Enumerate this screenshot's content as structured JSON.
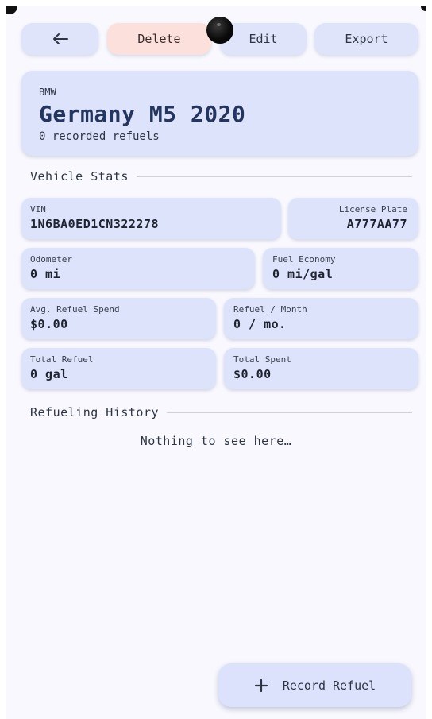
{
  "toolbar": {
    "back_icon": "arrow-left-icon",
    "delete_label": "Delete",
    "edit_label": "Edit",
    "export_label": "Export"
  },
  "vehicle": {
    "make": "BMW",
    "model": "Germany M5 2020",
    "refuels_text": "0 recorded refuels"
  },
  "sections": {
    "stats_title": "Vehicle Stats",
    "history_title": "Refueling History"
  },
  "stats": {
    "vin": {
      "label": "VIN",
      "value": "1N6BA0ED1CN322278"
    },
    "license_plate": {
      "label": "License Plate",
      "value": "A777AA77"
    },
    "odometer": {
      "label": "Odometer",
      "value": "0 mi"
    },
    "fuel_economy": {
      "label": "Fuel Economy",
      "value": "0 mi/gal"
    },
    "avg_refuel_spend": {
      "label": "Avg. Refuel Spend",
      "value": "$0.00"
    },
    "refuel_per_month": {
      "label": "Refuel / Month",
      "value": "0 / mo."
    },
    "total_refuel": {
      "label": "Total Refuel",
      "value": "0 gal"
    },
    "total_spent": {
      "label": "Total Spent",
      "value": "$0.00"
    }
  },
  "history": {
    "empty_message": "Nothing to see here…"
  },
  "fab": {
    "icon": "plus-icon",
    "label": "Record Refuel"
  },
  "colors": {
    "background": "#f8f8fe",
    "card": "#dde3fa",
    "delete_bg": "#fce0dc",
    "title": "#24365f"
  }
}
